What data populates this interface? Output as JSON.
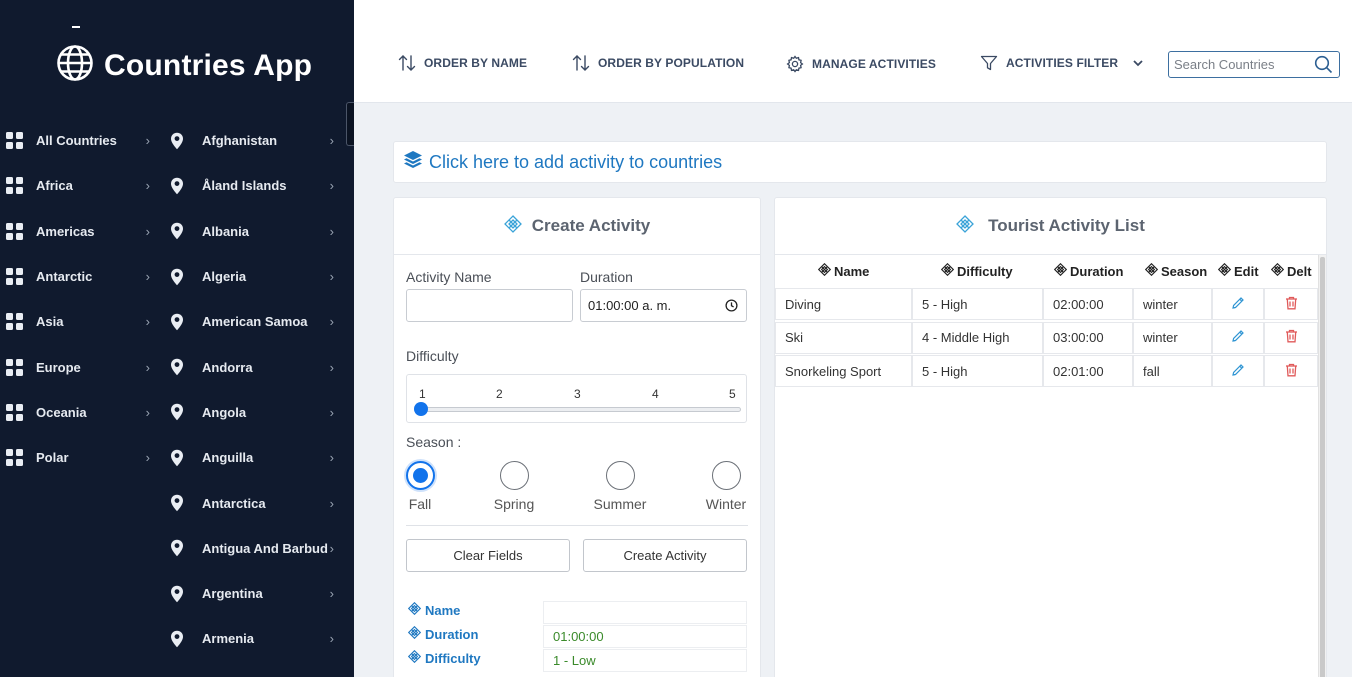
{
  "app": {
    "title": "Countries App"
  },
  "sidebar": {
    "continents": [
      {
        "label": "All Countries"
      },
      {
        "label": "Africa"
      },
      {
        "label": "Americas"
      },
      {
        "label": "Antarctic"
      },
      {
        "label": "Asia"
      },
      {
        "label": "Europe"
      },
      {
        "label": "Oceania"
      },
      {
        "label": "Polar"
      }
    ],
    "countries": [
      {
        "label": "Afghanistan"
      },
      {
        "label": "Åland Islands"
      },
      {
        "label": "Albania"
      },
      {
        "label": "Algeria"
      },
      {
        "label": "American Samoa"
      },
      {
        "label": "Andorra"
      },
      {
        "label": "Angola"
      },
      {
        "label": "Anguilla"
      },
      {
        "label": "Antarctica"
      },
      {
        "label": "Antigua And Barbud"
      },
      {
        "label": "Argentina"
      },
      {
        "label": "Armenia"
      }
    ],
    "arrow": "›"
  },
  "toolbar": {
    "order_by_name": "ORDER BY NAME",
    "order_by_population": "ORDER BY POPULATION",
    "manage_activities": "MANAGE ACTIVITIES",
    "activities_filter": "ACTIVITIES FILTER",
    "search_placeholder": "Search Countries"
  },
  "banner": {
    "text": "Click here to add activity to countries"
  },
  "create": {
    "title": "Create Activity",
    "activity_name_label": "Activity Name",
    "activity_name_value": "",
    "duration_label": "Duration",
    "duration_value": "01:00:00  a. m.",
    "difficulty_label": "Difficulty",
    "difficulty_ticks": [
      "1",
      "2",
      "3",
      "4",
      "5"
    ],
    "difficulty_value": 1,
    "season_label": "Season :",
    "seasons": [
      {
        "label": "Fall",
        "checked": true
      },
      {
        "label": "Spring",
        "checked": false
      },
      {
        "label": "Summer",
        "checked": false
      },
      {
        "label": "Winter",
        "checked": false
      }
    ],
    "clear_button": "Clear Fields",
    "create_button": "Create Activity",
    "preview": [
      {
        "label": "Name",
        "value": ""
      },
      {
        "label": "Duration",
        "value": "01:00:00"
      },
      {
        "label": "Difficulty",
        "value": "1 - Low"
      }
    ]
  },
  "list": {
    "title": "Tourist Activity List",
    "headers": [
      "Name",
      "Difficulty",
      "Duration",
      "Season",
      "Edit",
      "Delt"
    ],
    "rows": [
      {
        "name": "Diving",
        "difficulty": "5 - High",
        "duration": "02:00:00",
        "season": "winter"
      },
      {
        "name": "Ski",
        "difficulty": "4 - Middle High",
        "duration": "03:00:00",
        "season": "winter"
      },
      {
        "name": "Snorkeling Sport",
        "difficulty": "5 - High",
        "duration": "02:01:00",
        "season": "fall"
      }
    ]
  },
  "colors": {
    "sidebar_bg": "#101a2e",
    "accent_blue": "#1f78c1",
    "radio_blue": "#1273eb",
    "delete_red": "#e05a5a",
    "value_green": "#3a8a2a"
  },
  "icons": {
    "brand": "globe-icon",
    "continent": "grid-icon",
    "country": "map-pin-icon",
    "order": "sort-arrows-icon",
    "manage": "gear-icon",
    "filter": "filter-icon",
    "search": "search-icon",
    "banner": "layers-icon",
    "header": "diamond-icon",
    "edit": "pencil-icon",
    "delete": "trash-icon"
  }
}
